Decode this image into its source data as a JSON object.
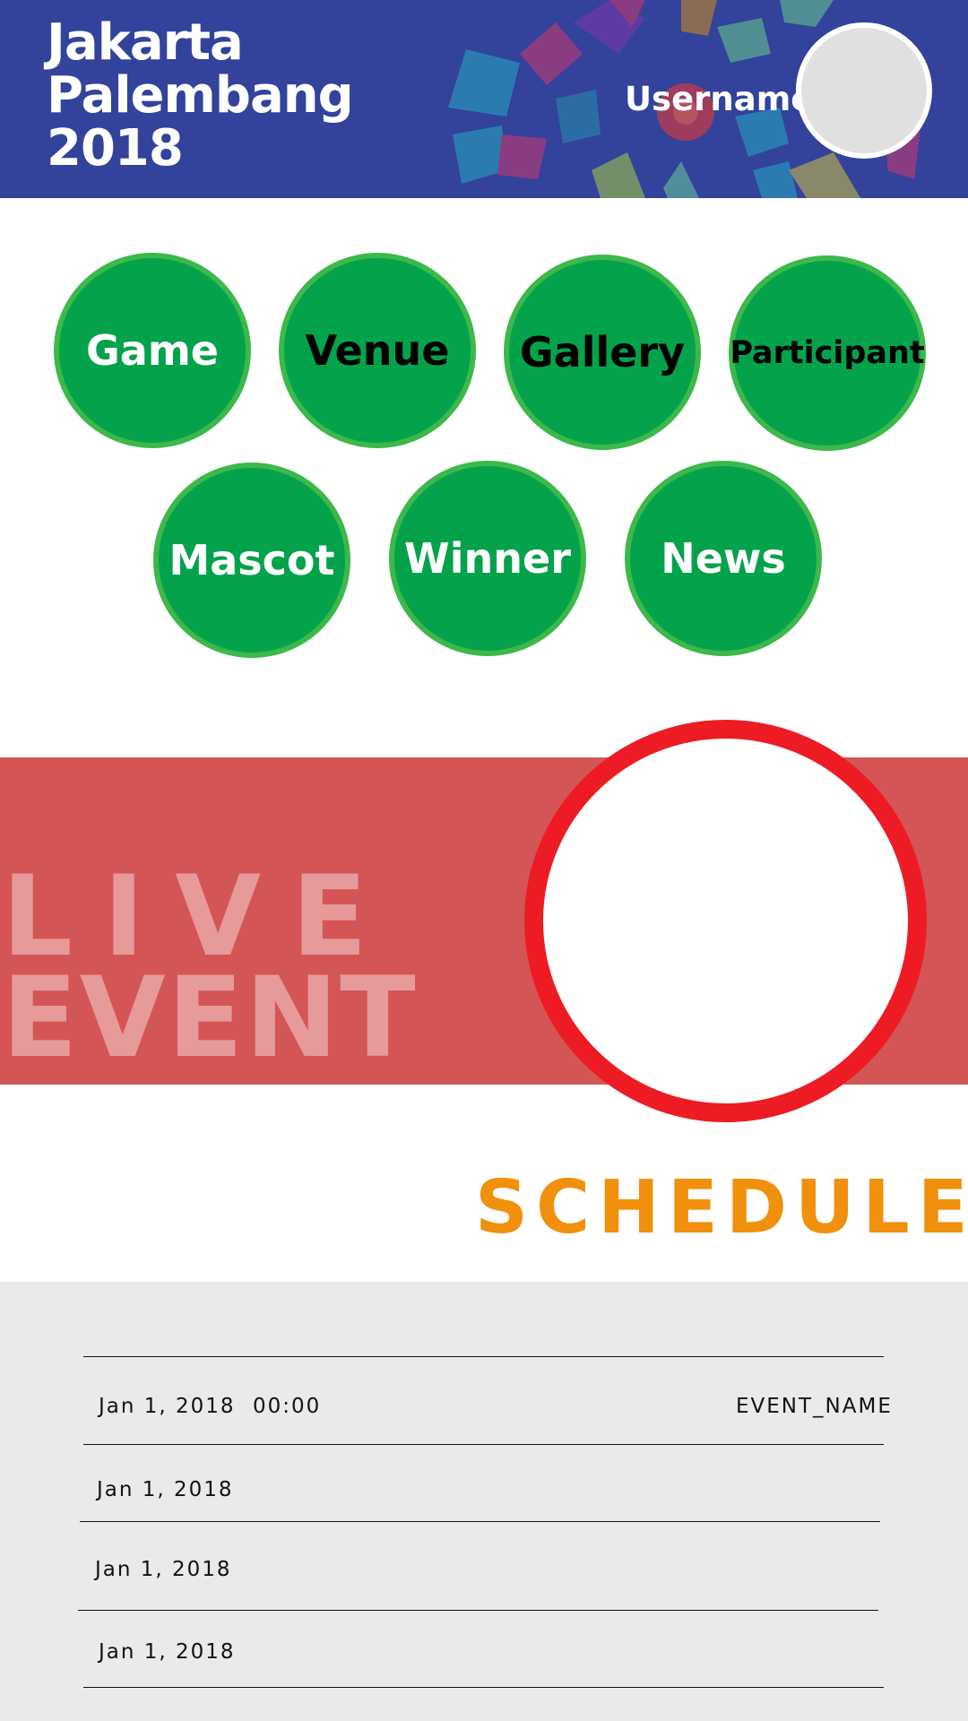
{
  "header": {
    "logo_lines": [
      "Jakarta",
      "Palembang",
      "2018"
    ],
    "username": "Username"
  },
  "menu": {
    "game": "Game",
    "venue": "Venue",
    "gallery": "Gallery",
    "participant": "Participant",
    "mascot": "Mascot",
    "winner": "Winner",
    "news": "News"
  },
  "live": {
    "line1": "LIVE",
    "line2": "EVENT"
  },
  "schedule": {
    "title": "SCHEDULE",
    "rows": [
      {
        "date": "Jan 1, 2018",
        "time": "00:00",
        "event": "EVENT_NAME"
      },
      {
        "date": "Jan 1, 2018"
      },
      {
        "date": "Jan 1, 2018"
      },
      {
        "date": "Jan 1, 2018"
      }
    ]
  },
  "colors": {
    "header_bg": "#33429a",
    "menu_green": "#05a24c",
    "menu_border": "#3db84a",
    "live_band": "#d45555",
    "live_ring": "#ed1c24",
    "schedule_title": "#f0900c",
    "schedule_bg": "#eaeaea"
  }
}
